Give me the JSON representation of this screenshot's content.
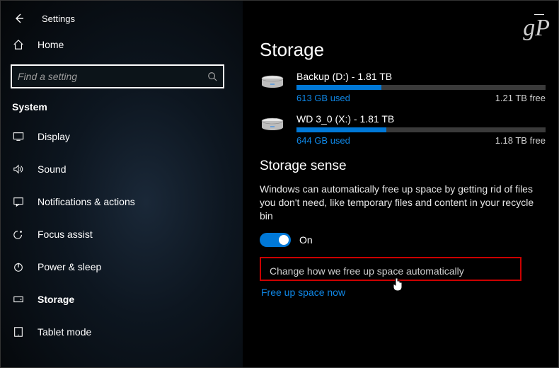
{
  "app": {
    "title": "Settings"
  },
  "watermark": "gP",
  "sidebar": {
    "home": "Home",
    "search_placeholder": "Find a setting",
    "category": "System",
    "items": [
      {
        "label": "Display"
      },
      {
        "label": "Sound"
      },
      {
        "label": "Notifications & actions"
      },
      {
        "label": "Focus assist"
      },
      {
        "label": "Power & sleep"
      },
      {
        "label": "Storage"
      },
      {
        "label": "Tablet mode"
      }
    ]
  },
  "page": {
    "title": "Storage",
    "drives": [
      {
        "title": "Backup (D:) - 1.81 TB",
        "used": "613 GB used",
        "free": "1.21 TB free",
        "fill_pct": 34
      },
      {
        "title": "WD 3_0 (X:) - 1.81 TB",
        "used": "644 GB used",
        "free": "1.18 TB free",
        "fill_pct": 36
      }
    ],
    "sense": {
      "heading": "Storage sense",
      "desc": "Windows can automatically free up space by getting rid of files you don't need, like temporary files and content in your recycle bin",
      "toggle_state": "On",
      "change_link": "Change how we free up space automatically",
      "free_now": "Free up space now"
    }
  }
}
